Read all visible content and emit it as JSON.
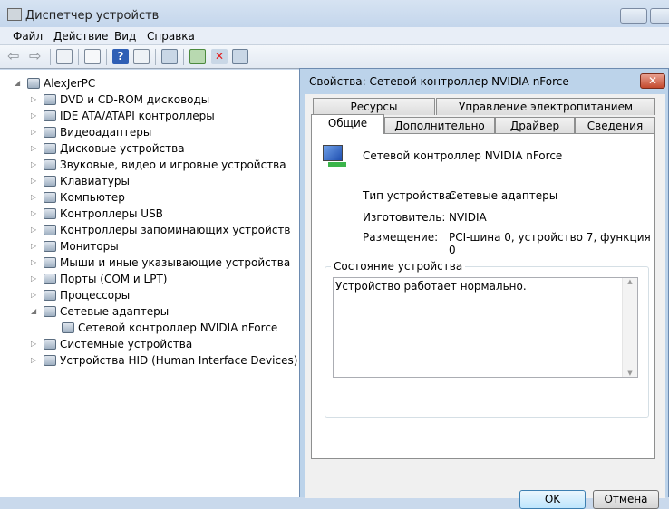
{
  "window": {
    "title": "Диспетчер устройств"
  },
  "menu": [
    "Файл",
    "Действие",
    "Вид",
    "Справка"
  ],
  "toolbar": [
    "back-icon",
    "forward-icon",
    "show-hide-tree-icon",
    "properties-icon",
    "help-icon",
    "action-pane-icon",
    "scan-hardware-icon",
    "update-driver-icon",
    "disable-device-icon",
    "uninstall-device-icon"
  ],
  "tree": {
    "root": "AlexJerPC",
    "items": [
      "DVD и CD-ROM дисководы",
      "IDE ATA/ATAPI контроллеры",
      "Видеоадаптеры",
      "Дисковые устройства",
      "Звуковые, видео и игровые устройства",
      "Клавиатуры",
      "Компьютер",
      "Контроллеры USB",
      "Контроллеры запоминающих устройств",
      "Мониторы",
      "Мыши и иные указывающие устройства",
      "Порты (COM и LPT)",
      "Процессоры",
      "Сетевые адаптеры"
    ],
    "child": "Сетевой контроллер NVIDIA nForce",
    "items_after": [
      "Системные устройства",
      "Устройства HID (Human Interface Devices)"
    ]
  },
  "dialog": {
    "title": "Свойства: Сетевой контроллер NVIDIA nForce",
    "close": "✕",
    "tabs_row1": [
      "Ресурсы",
      "Управление электропитанием"
    ],
    "tabs_row2": [
      "Общие",
      "Дополнительно",
      "Драйвер",
      "Сведения"
    ],
    "device_name": "Сетевой контроллер NVIDIA nForce",
    "props": [
      {
        "label": "Тип устройства:",
        "value": "Сетевые адаптеры"
      },
      {
        "label": "Изготовитель:",
        "value": "NVIDIA"
      },
      {
        "label": "Размещение:",
        "value": "PCI-шина 0, устройство 7, функция 0"
      }
    ],
    "status_group": "Состояние устройства",
    "status_text": "Устройство работает нормально.",
    "ok": "OK",
    "cancel": "Отмена"
  }
}
